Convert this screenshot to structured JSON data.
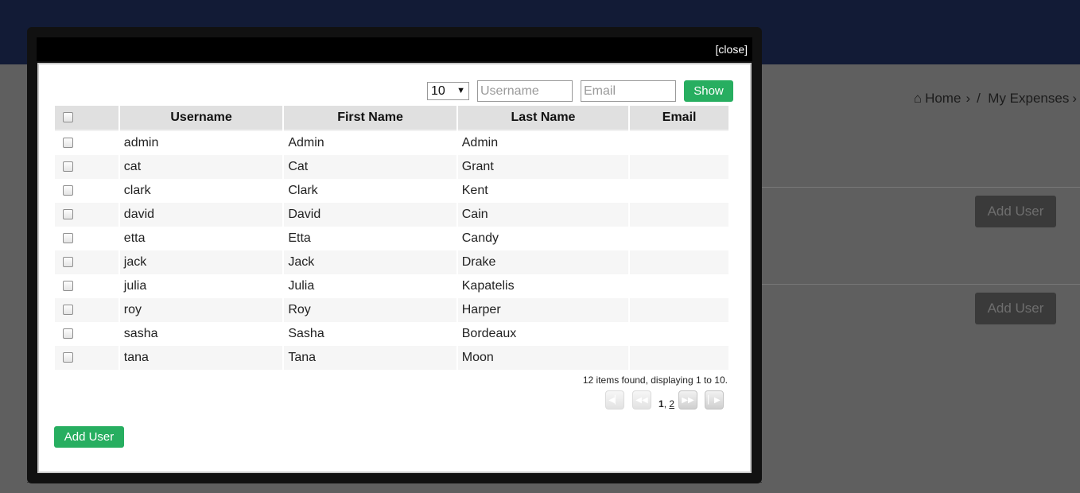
{
  "background": {
    "breadcrumb": {
      "home": "Home",
      "current": "My Expenses",
      "separator": "›"
    },
    "add_user_buttons": [
      "Add User",
      "Add User"
    ]
  },
  "modal": {
    "close_label": "[close]",
    "filters": {
      "page_size": "10",
      "username_placeholder": "Username",
      "email_placeholder": "Email",
      "show_label": "Show"
    },
    "table": {
      "columns": [
        "Username",
        "First Name",
        "Last Name",
        "Email"
      ],
      "rows": [
        {
          "username": "admin",
          "first": "Admin",
          "last": "Admin",
          "email": ""
        },
        {
          "username": "cat",
          "first": "Cat",
          "last": "Grant",
          "email": ""
        },
        {
          "username": "clark",
          "first": "Clark",
          "last": "Kent",
          "email": ""
        },
        {
          "username": "david",
          "first": "David",
          "last": "Cain",
          "email": ""
        },
        {
          "username": "etta",
          "first": "Etta",
          "last": "Candy",
          "email": ""
        },
        {
          "username": "jack",
          "first": "Jack",
          "last": "Drake",
          "email": ""
        },
        {
          "username": "julia",
          "first": "Julia",
          "last": "Kapatelis",
          "email": ""
        },
        {
          "username": "roy",
          "first": "Roy",
          "last": "Harper",
          "email": ""
        },
        {
          "username": "sasha",
          "first": "Sasha",
          "last": "Bordeaux",
          "email": ""
        },
        {
          "username": "tana",
          "first": "Tana",
          "last": "Moon",
          "email": ""
        }
      ]
    },
    "status": "12 items found, displaying 1 to 10.",
    "pager": {
      "current": "1",
      "separator": ",",
      "next_page": "2"
    },
    "add_user_label": "Add User"
  },
  "colors": {
    "header": "#121b36",
    "accent_green": "#27ae60"
  },
  "icons": [
    "home-icon",
    "first-page-icon",
    "prev-page-icon",
    "next-page-icon",
    "last-page-icon"
  ]
}
